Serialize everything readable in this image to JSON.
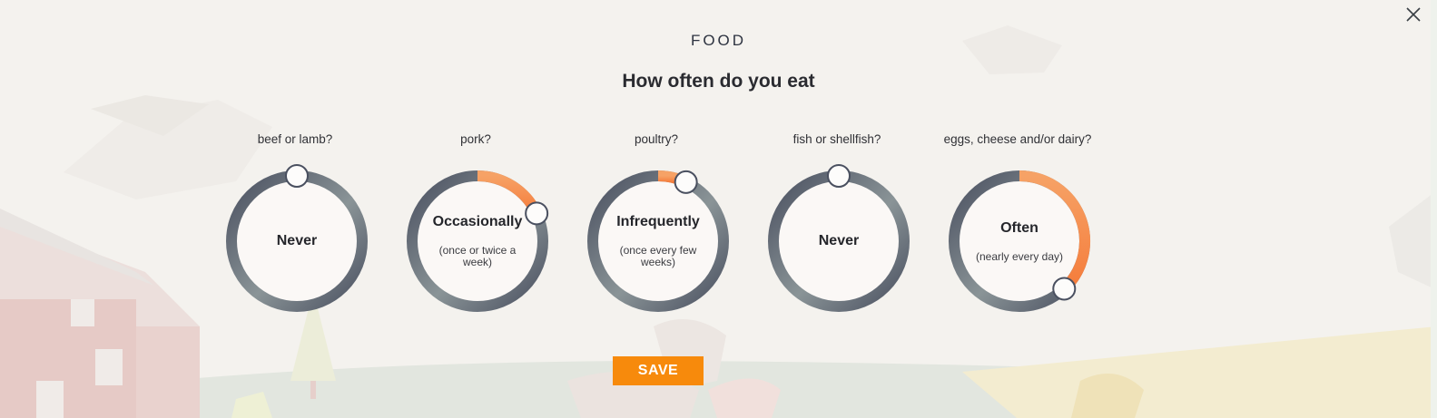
{
  "dialog": {
    "category": "FOOD",
    "title": "How often do you eat"
  },
  "questions": [
    {
      "question": "beef or lamb?",
      "answer": "Never",
      "note": "",
      "level": 0
    },
    {
      "question": "pork?",
      "answer": "Occasionally",
      "note": "(once or twice a week)",
      "level": 0.18
    },
    {
      "question": "poultry?",
      "answer": "Infrequently",
      "note": "(once every few weeks)",
      "level": 0.07
    },
    {
      "question": "fish or shellfish?",
      "answer": "Never",
      "note": "",
      "level": 0
    },
    {
      "question": "eggs, cheese and/or dairy?",
      "answer": "Often",
      "note": "(nearly every day)",
      "level": 0.38
    }
  ],
  "actions": {
    "save_label": "SAVE",
    "close_icon": "close-icon"
  },
  "colors": {
    "accent": "#f78a0c",
    "ring_dark": "#4a5060",
    "ring_light": "#8a9497",
    "fill_start": "#f6a266",
    "fill_end": "#f57c3b"
  }
}
